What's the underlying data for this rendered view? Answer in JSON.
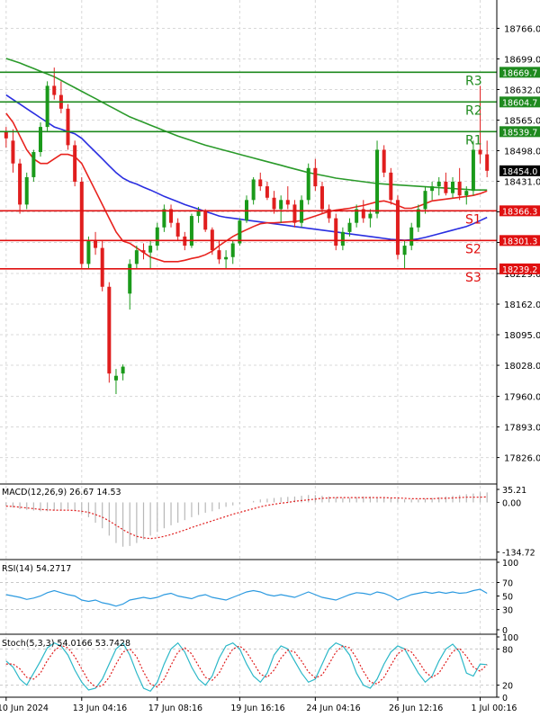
{
  "chart_data": {
    "type": "candlestick",
    "price_axis": {
      "range": [
        17772,
        18828
      ],
      "ticks": [
        18766.0,
        18699.0,
        18632.0,
        18565.0,
        18498.0,
        18431.0,
        18364.0,
        18297.0,
        18229.0,
        18162.0,
        18095.0,
        18028.0,
        17960.0,
        17893.0,
        17826.0
      ],
      "tick_labels": [
        "18766.0",
        "18699.0",
        "18632.0",
        "18565.0",
        "18498.0",
        "18431.0",
        "",
        "",
        "18229.0",
        "18162.0",
        "18095.0",
        "18028.0",
        "17960.0",
        "17893.0",
        "17826.0"
      ]
    },
    "x_axis": {
      "labels": [
        {
          "bar": 0,
          "text": "10 Jun 2024"
        },
        {
          "bar": 11,
          "text": "13 Jun 04:16"
        },
        {
          "bar": 22,
          "text": "17 Jun 08:16"
        },
        {
          "bar": 34,
          "text": "19 Jun 16:16"
        },
        {
          "bar": 45,
          "text": "24 Jun 04:16"
        },
        {
          "bar": 57,
          "text": "26 Jun 12:16"
        },
        {
          "bar": 69,
          "text": "1 Jul 00:16"
        }
      ]
    },
    "current_price": "18454.0",
    "levels": [
      {
        "label": "R3",
        "value": 18669.7,
        "tag": "18669.7",
        "color": "#1e8a1e"
      },
      {
        "label": "R2",
        "value": 18604.7,
        "tag": "18604.7",
        "color": "#1e8a1e"
      },
      {
        "label": "R1",
        "value": 18539.7,
        "tag": "18539.7",
        "color": "#1e8a1e"
      },
      {
        "label": "S1",
        "value": 18366.3,
        "tag": "18366.3",
        "color": "#e01010"
      },
      {
        "label": "S2",
        "value": 18301.3,
        "tag": "18301.3",
        "color": "#e01010"
      },
      {
        "label": "S3",
        "value": 18239.2,
        "tag": "18239.2",
        "color": "#e01010"
      }
    ],
    "candles": [
      [
        18540,
        18550,
        18505,
        18525
      ],
      [
        18520,
        18545,
        18450,
        18470
      ],
      [
        18470,
        18480,
        18360,
        18380
      ],
      [
        18380,
        18450,
        18370,
        18440
      ],
      [
        18440,
        18500,
        18430,
        18495
      ],
      [
        18495,
        18560,
        18485,
        18550
      ],
      [
        18550,
        18650,
        18540,
        18640
      ],
      [
        18640,
        18680,
        18610,
        18620
      ],
      [
        18620,
        18650,
        18580,
        18590
      ],
      [
        18590,
        18600,
        18500,
        18510
      ],
      [
        18510,
        18520,
        18420,
        18430
      ],
      [
        18430,
        18440,
        18240,
        18250
      ],
      [
        18250,
        18310,
        18240,
        18300
      ],
      [
        18300,
        18320,
        18270,
        18285
      ],
      [
        18285,
        18300,
        18190,
        18200
      ],
      [
        18200,
        18210,
        17990,
        18010
      ],
      [
        17995,
        18020,
        17965,
        18005
      ],
      [
        18010,
        18030,
        17995,
        18025
      ],
      [
        18185,
        18260,
        18150,
        18250
      ],
      [
        18250,
        18290,
        18240,
        18280
      ],
      [
        18280,
        18295,
        18260,
        18275
      ],
      [
        18275,
        18300,
        18240,
        18290
      ],
      [
        18290,
        18340,
        18280,
        18330
      ],
      [
        18330,
        18380,
        18320,
        18370
      ],
      [
        18370,
        18380,
        18330,
        18340
      ],
      [
        18340,
        18350,
        18300,
        18310
      ],
      [
        18310,
        18320,
        18280,
        18290
      ],
      [
        18290,
        18360,
        18285,
        18355
      ],
      [
        18355,
        18375,
        18340,
        18365
      ],
      [
        18365,
        18370,
        18320,
        18325
      ],
      [
        18325,
        18330,
        18270,
        18280
      ],
      [
        18280,
        18300,
        18250,
        18260
      ],
      [
        18260,
        18280,
        18240,
        18265
      ],
      [
        18265,
        18300,
        18250,
        18295
      ],
      [
        18295,
        18350,
        18290,
        18345
      ],
      [
        18345,
        18400,
        18340,
        18390
      ],
      [
        18390,
        18440,
        18380,
        18435
      ],
      [
        18435,
        18450,
        18410,
        18420
      ],
      [
        18420,
        18430,
        18390,
        18395
      ],
      [
        18395,
        18410,
        18360,
        18370
      ],
      [
        18370,
        18400,
        18340,
        18390
      ],
      [
        18390,
        18420,
        18370,
        18380
      ],
      [
        18380,
        18390,
        18330,
        18340
      ],
      [
        18340,
        18400,
        18330,
        18390
      ],
      [
        18390,
        18470,
        18380,
        18460
      ],
      [
        18460,
        18480,
        18410,
        18420
      ],
      [
        18420,
        18430,
        18360,
        18370
      ],
      [
        18370,
        18380,
        18340,
        18350
      ],
      [
        18350,
        18360,
        18280,
        18290
      ],
      [
        18290,
        18330,
        18280,
        18320
      ],
      [
        18320,
        18350,
        18310,
        18340
      ],
      [
        18340,
        18380,
        18330,
        18370
      ],
      [
        18370,
        18390,
        18340,
        18350
      ],
      [
        18350,
        18370,
        18330,
        18360
      ],
      [
        18360,
        18520,
        18350,
        18500
      ],
      [
        18500,
        18510,
        18440,
        18450
      ],
      [
        18450,
        18460,
        18380,
        18390
      ],
      [
        18390,
        18400,
        18260,
        18270
      ],
      [
        18270,
        18300,
        18240,
        18290
      ],
      [
        18290,
        18340,
        18280,
        18330
      ],
      [
        18330,
        18380,
        18320,
        18370
      ],
      [
        18370,
        18420,
        18360,
        18410
      ],
      [
        18410,
        18430,
        18390,
        18420
      ],
      [
        18420,
        18440,
        18400,
        18430
      ],
      [
        18430,
        18450,
        18400,
        18405
      ],
      [
        18405,
        18440,
        18395,
        18430
      ],
      [
        18430,
        18460,
        18390,
        18400
      ],
      [
        18400,
        18420,
        18380,
        18410
      ],
      [
        18410,
        18520,
        18400,
        18500
      ],
      [
        18500,
        18640,
        18470,
        18490
      ],
      [
        18490,
        18520,
        18440,
        18454
      ]
    ],
    "ma_fast": {
      "color": "#e8231e",
      "values": [
        18580,
        18560,
        18530,
        18500,
        18480,
        18470,
        18470,
        18480,
        18490,
        18490,
        18485,
        18470,
        18440,
        18410,
        18380,
        18350,
        18320,
        18300,
        18295,
        18285,
        18275,
        18265,
        18260,
        18255,
        18255,
        18255,
        18258,
        18262,
        18265,
        18270,
        18278,
        18290,
        18300,
        18310,
        18318,
        18325,
        18332,
        18338,
        18340,
        18340,
        18341,
        18342,
        18343,
        18345,
        18350,
        18355,
        18360,
        18365,
        18368,
        18370,
        18372,
        18375,
        18378,
        18382,
        18386,
        18388,
        18384,
        18378,
        18372,
        18372,
        18376,
        18382,
        18388,
        18390,
        18392,
        18394,
        18396,
        18398,
        18400,
        18404,
        18410
      ]
    },
    "ma_mid": {
      "color": "#2a2ee0",
      "values": [
        18620,
        18610,
        18600,
        18590,
        18580,
        18570,
        18560,
        18550,
        18545,
        18540,
        18535,
        18525,
        18510,
        18495,
        18480,
        18465,
        18450,
        18438,
        18430,
        18425,
        18418,
        18412,
        18405,
        18398,
        18392,
        18386,
        18380,
        18375,
        18370,
        18365,
        18360,
        18355,
        18352,
        18350,
        18348,
        18346,
        18344,
        18342,
        18340,
        18338,
        18336,
        18334,
        18332,
        18330,
        18328,
        18326,
        18324,
        18322,
        18320,
        18318,
        18316,
        18314,
        18312,
        18310,
        18308,
        18306,
        18304,
        18303,
        18302,
        18303,
        18305,
        18308,
        18312,
        18316,
        18320,
        18324,
        18328,
        18332,
        18338,
        18345,
        18352
      ]
    },
    "ma_slow": {
      "color": "#2a9a2a",
      "values": [
        18700,
        18695,
        18690,
        18684,
        18678,
        18672,
        18666,
        18660,
        18652,
        18644,
        18636,
        18628,
        18620,
        18612,
        18604,
        18596,
        18588,
        18580,
        18572,
        18566,
        18560,
        18554,
        18548,
        18542,
        18536,
        18530,
        18525,
        18520,
        18515,
        18510,
        18506,
        18502,
        18498,
        18494,
        18490,
        18486,
        18482,
        18478,
        18474,
        18470,
        18466,
        18462,
        18458,
        18454,
        18450,
        18447,
        18444,
        18441,
        18438,
        18436,
        18434,
        18432,
        18430,
        18428,
        18426,
        18425,
        18424,
        18423,
        18422,
        18421,
        18420,
        18419,
        18418,
        18417,
        18416,
        18415,
        18414,
        18413,
        18412,
        18412,
        18412
      ]
    },
    "macd": {
      "title": "MACD(12,26,9) 26.67 14.53",
      "axis_labels": [
        "35.21",
        "0.00",
        "-134.72"
      ],
      "range": [
        -150,
        45
      ],
      "histogram": [
        -10,
        -14,
        -18,
        -20,
        -22,
        -24,
        -24,
        -22,
        -20,
        -18,
        -22,
        -30,
        -40,
        -55,
        -70,
        -90,
        -110,
        -120,
        -118,
        -110,
        -100,
        -90,
        -80,
        -70,
        -62,
        -55,
        -48,
        -40,
        -34,
        -28,
        -24,
        -18,
        -12,
        -8,
        -4,
        0,
        4,
        8,
        10,
        12,
        14,
        15,
        16,
        18,
        20,
        20,
        18,
        16,
        14,
        12,
        12,
        14,
        16,
        16,
        14,
        14,
        12,
        10,
        8,
        8,
        8,
        10,
        12,
        14,
        16,
        18,
        20,
        22,
        24,
        27,
        27
      ],
      "signal": [
        -10,
        -11,
        -13,
        -15,
        -17,
        -19,
        -20,
        -21,
        -21,
        -21,
        -22,
        -24,
        -27,
        -33,
        -40,
        -50,
        -62,
        -74,
        -84,
        -92,
        -96,
        -98,
        -96,
        -92,
        -87,
        -81,
        -75,
        -68,
        -62,
        -56,
        -50,
        -44,
        -38,
        -32,
        -27,
        -22,
        -17,
        -12,
        -8,
        -5,
        -2,
        0,
        3,
        5,
        7,
        9,
        11,
        12,
        13,
        13,
        13,
        13,
        13,
        13,
        13,
        13,
        12,
        12,
        11,
        10,
        10,
        10,
        10,
        11,
        11,
        12,
        13,
        14,
        14,
        14,
        15
      ]
    },
    "rsi": {
      "title": "RSI(14) 54.2717",
      "axis_labels": [
        "100",
        "70",
        "50",
        "30",
        "0"
      ],
      "range": [
        0,
        100
      ],
      "values": [
        52,
        50,
        48,
        45,
        47,
        50,
        55,
        58,
        55,
        52,
        50,
        44,
        42,
        44,
        40,
        38,
        35,
        38,
        44,
        46,
        48,
        46,
        48,
        52,
        54,
        50,
        48,
        46,
        50,
        52,
        48,
        46,
        44,
        48,
        52,
        56,
        58,
        56,
        52,
        50,
        52,
        50,
        48,
        52,
        56,
        52,
        48,
        46,
        44,
        48,
        52,
        55,
        54,
        52,
        56,
        54,
        50,
        44,
        48,
        52,
        54,
        56,
        54,
        56,
        54,
        56,
        54,
        55,
        58,
        60,
        54
      ]
    },
    "stoch": {
      "title": "Stoch(5,3,3) 54.0166 53.7428",
      "axis_labels": [
        "100",
        "80",
        "20",
        "0"
      ],
      "range": [
        0,
        100
      ],
      "k": [
        60,
        50,
        30,
        20,
        40,
        60,
        82,
        90,
        85,
        70,
        45,
        25,
        12,
        15,
        30,
        55,
        80,
        90,
        70,
        40,
        15,
        10,
        25,
        55,
        80,
        90,
        75,
        50,
        30,
        20,
        35,
        65,
        85,
        90,
        80,
        55,
        35,
        25,
        40,
        70,
        85,
        80,
        60,
        40,
        25,
        30,
        55,
        80,
        90,
        85,
        70,
        40,
        20,
        15,
        30,
        55,
        75,
        85,
        80,
        60,
        40,
        25,
        35,
        60,
        80,
        88,
        75,
        40,
        35,
        55,
        54
      ],
      "d": [
        55,
        55,
        47,
        33,
        30,
        40,
        61,
        77,
        86,
        82,
        67,
        47,
        27,
        17,
        19,
        33,
        55,
        75,
        80,
        67,
        42,
        22,
        17,
        30,
        53,
        75,
        82,
        72,
        52,
        33,
        28,
        40,
        62,
        80,
        85,
        75,
        57,
        38,
        33,
        45,
        65,
        78,
        75,
        60,
        42,
        32,
        37,
        55,
        75,
        85,
        82,
        65,
        43,
        25,
        22,
        33,
        53,
        72,
        80,
        75,
        60,
        42,
        33,
        40,
        58,
        76,
        81,
        68,
        50,
        43,
        54
      ]
    }
  }
}
